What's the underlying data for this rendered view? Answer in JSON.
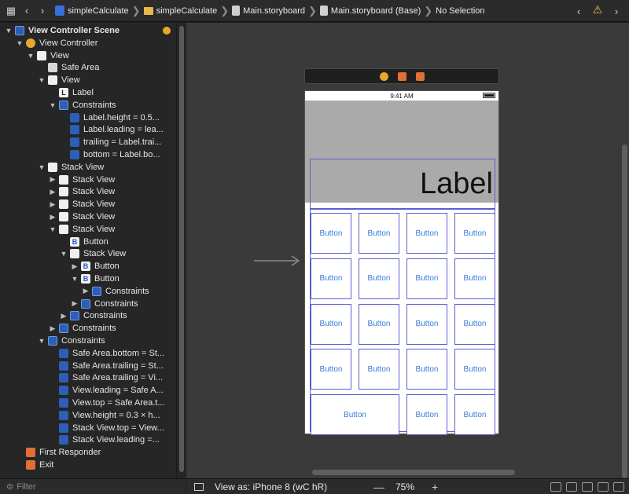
{
  "jumpbar": {
    "crumbs": [
      {
        "label": "simpleCalculate",
        "icon": "xcode-project-icon"
      },
      {
        "label": "simpleCalculate",
        "icon": "folder-icon"
      },
      {
        "label": "Main.storyboard",
        "icon": "storyboard-file-icon"
      },
      {
        "label": "Main.storyboard (Base)",
        "icon": "storyboard-file-icon"
      },
      {
        "label": "No Selection",
        "icon": ""
      }
    ]
  },
  "outline": {
    "rows": [
      {
        "label": "View Controller Scene",
        "icon": "scene",
        "disc": "▼",
        "bold": true
      },
      {
        "label": "View Controller",
        "icon": "vc",
        "disc": "▼"
      },
      {
        "label": "View",
        "icon": "view",
        "disc": "▼"
      },
      {
        "label": "Safe Area",
        "icon": "safe",
        "disc": ""
      },
      {
        "label": "View",
        "icon": "view",
        "disc": "▼"
      },
      {
        "label": "Label",
        "icon": "label",
        "disc": ""
      },
      {
        "label": "Constraints",
        "icon": "cons",
        "disc": "▼"
      },
      {
        "label": "Label.height = 0.5...",
        "icon": "ct",
        "disc": ""
      },
      {
        "label": "Label.leading = lea...",
        "icon": "ct",
        "disc": ""
      },
      {
        "label": "trailing = Label.trai...",
        "icon": "ct",
        "disc": ""
      },
      {
        "label": "bottom = Label.bo...",
        "icon": "ct",
        "disc": ""
      },
      {
        "label": "Stack View",
        "icon": "stack",
        "disc": "▼"
      },
      {
        "label": "Stack View",
        "icon": "stack",
        "disc": "▶"
      },
      {
        "label": "Stack View",
        "icon": "stack",
        "disc": "▶"
      },
      {
        "label": "Stack View",
        "icon": "stack",
        "disc": "▶"
      },
      {
        "label": "Stack View",
        "icon": "stack",
        "disc": "▶"
      },
      {
        "label": "Stack View",
        "icon": "stack",
        "disc": "▼"
      },
      {
        "label": "Button",
        "icon": "btn",
        "disc": ""
      },
      {
        "label": "Stack View",
        "icon": "stack",
        "disc": "▼"
      },
      {
        "label": "Button",
        "icon": "btn",
        "disc": "▶"
      },
      {
        "label": "Button",
        "icon": "btn",
        "disc": "▼"
      },
      {
        "label": "Constraints",
        "icon": "cons",
        "disc": "▶"
      },
      {
        "label": "Constraints",
        "icon": "cons",
        "disc": "▶"
      },
      {
        "label": "Constraints",
        "icon": "cons",
        "disc": "▶"
      },
      {
        "label": "Constraints",
        "icon": "cons",
        "disc": "▶"
      },
      {
        "label": "Constraints",
        "icon": "cons",
        "disc": "▼"
      },
      {
        "label": "Safe Area.bottom = St...",
        "icon": "ct",
        "disc": ""
      },
      {
        "label": "Safe Area.trailing = St...",
        "icon": "ct",
        "disc": ""
      },
      {
        "label": "Safe Area.trailing = Vi...",
        "icon": "ct",
        "disc": ""
      },
      {
        "label": "View.leading = Safe A...",
        "icon": "ct",
        "disc": ""
      },
      {
        "label": "View.top = Safe Area.t...",
        "icon": "ct",
        "disc": ""
      },
      {
        "label": "View.height = 0.3 × h...",
        "icon": "ct",
        "disc": ""
      },
      {
        "label": "Stack View.top = View...",
        "icon": "ct",
        "disc": ""
      },
      {
        "label": "Stack View.leading =...",
        "icon": "ct",
        "disc": ""
      },
      {
        "label": "First Responder",
        "icon": "fr",
        "disc": ""
      },
      {
        "label": "Exit",
        "icon": "exit",
        "disc": ""
      }
    ],
    "filter_placeholder": "Filter"
  },
  "canvas": {
    "status_time": "9:41 AM",
    "label_text": "Label",
    "keys": [
      [
        "Button",
        "Button",
        "Button",
        "Button"
      ],
      [
        "Button",
        "Button",
        "Button",
        "Button"
      ],
      [
        "Button",
        "Button",
        "Button",
        "Button"
      ],
      [
        "Button",
        "Button",
        "Button",
        "Button"
      ],
      [
        "Button",
        "Button",
        "Button"
      ]
    ]
  },
  "bottombar": {
    "view_as": "View as: iPhone 8 (wC hR)",
    "zoom": "75%",
    "zoom_minus": "—",
    "zoom_plus": "+"
  },
  "colors": {
    "accent": "#3a7bd5",
    "constraint_outline": "#5a5fd0",
    "warning": "#e8c13c"
  }
}
